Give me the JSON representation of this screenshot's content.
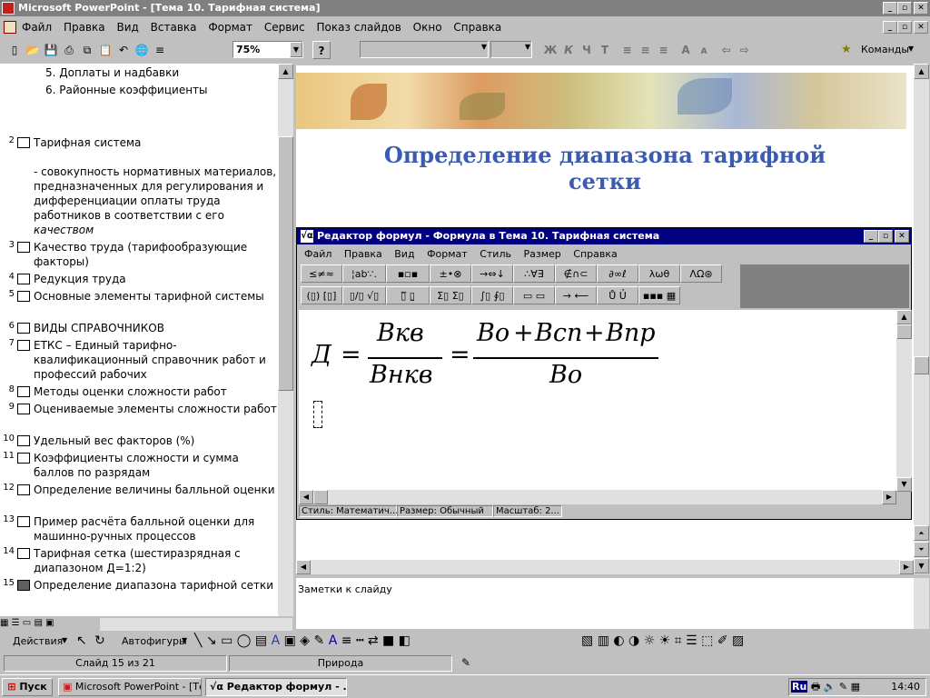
{
  "app": {
    "title": "Microsoft PowerPoint - [Тема 10. Тарифная система]",
    "menu": [
      "Файл",
      "Правка",
      "Вид",
      "Вставка",
      "Формат",
      "Сервис",
      "Показ слайдов",
      "Окно",
      "Справка"
    ],
    "zoom": "75%",
    "commands_label": "Команды",
    "font_buttons": [
      "Ж",
      "К",
      "Ч",
      "Т"
    ]
  },
  "outline": {
    "pre_items": [
      "5.  Доплаты и надбавки",
      "6.  Районные коэффициенты"
    ],
    "slides": [
      {
        "num": "2",
        "title": "Тарифная система",
        "body": "- совокупность нормативных материалов, предназначенных для регулирования и дифференциации оплаты труда работников в соответствии с его ",
        "body_italic": "качеством"
      },
      {
        "num": "3",
        "title": "Качество труда (тарифообразующие факторы)"
      },
      {
        "num": "4",
        "title": "Редукция труда"
      },
      {
        "num": "5",
        "title": "Основные элементы тарифной системы"
      },
      {
        "num": "6",
        "title": "ВИДЫ СПРАВОЧНИКОВ"
      },
      {
        "num": "7",
        "title": "ЕТКС – Единый тарифно-квалификационный справочник работ и профессий рабочих"
      },
      {
        "num": "8",
        "title": "Методы оценки сложности работ"
      },
      {
        "num": "9",
        "title": "Оцениваемые элементы сложности работ"
      },
      {
        "num": "10",
        "title": "Удельный вес факторов (%)"
      },
      {
        "num": "11",
        "title": "Коэффициенты сложности и сумма баллов по разрядам"
      },
      {
        "num": "12",
        "title": "Определение величины балльной оценки"
      },
      {
        "num": "13",
        "title": " Пример расчёта балльной оценки для машинно-ручных процессов"
      },
      {
        "num": "14",
        "title": "Тарифная сетка (шестиразрядная с диапазоном Д=1:2)"
      },
      {
        "num": "15",
        "title": "Определение диапазона тарифной сетки"
      }
    ]
  },
  "slide": {
    "title": "Определение диапазона тарифной сетки"
  },
  "equation_editor": {
    "title": "Редактор формул - Формула в Тема 10. Тарифная система",
    "menu": [
      "Файл",
      "Правка",
      "Вид",
      "Формат",
      "Стиль",
      "Размер",
      "Справка"
    ],
    "palette_row1": [
      "≤≠≈",
      "¦ab∵.",
      "▪▫▪",
      "±•⊗",
      "→⇔↓",
      "∴∀∃",
      "∉∩⊂",
      "∂∞ℓ",
      "λωθ",
      "ΛΩ⊛"
    ],
    "palette_row2": [
      "(▯) [▯]",
      "▯/▯ √▯",
      "▯̅ ▯̰",
      "Σ▯ Σ▯",
      "∫▯ ∮▯",
      "▭ ▭",
      "→ ⟵",
      "Ů Ủ",
      "▪▪▪ ▦"
    ],
    "formula": {
      "lhs": "Д",
      "eq": "=",
      "frac1_num": "Bкв",
      "frac1_den": "Bнкв",
      "frac2_num_a": "Bo",
      "plus1": "+",
      "frac2_num_b": "Bсп",
      "plus2": "+",
      "frac2_num_c": "Bпр",
      "frac2_den": "Bo"
    },
    "status": {
      "style": "Стиль: Математич...",
      "size": "Размер: Обычный",
      "scale": "Масштаб: 2..."
    }
  },
  "notes": {
    "placeholder": "Заметки к слайду"
  },
  "drawing_toolbar": {
    "actions": "Действия",
    "autoshapes": "Автофигуры"
  },
  "statusbar": {
    "slide": "Слайд 15 из 21",
    "design": "Природа"
  },
  "taskbar": {
    "start": "Пуск",
    "tasks": [
      "Microsoft PowerPoint - [Те...",
      "Редактор формул - ..."
    ],
    "lang": "Ru",
    "clock": "14:40"
  },
  "colors": {
    "title_text": "#3a5bb0",
    "active_caption": "#000080",
    "inactive_caption": "#808080"
  }
}
